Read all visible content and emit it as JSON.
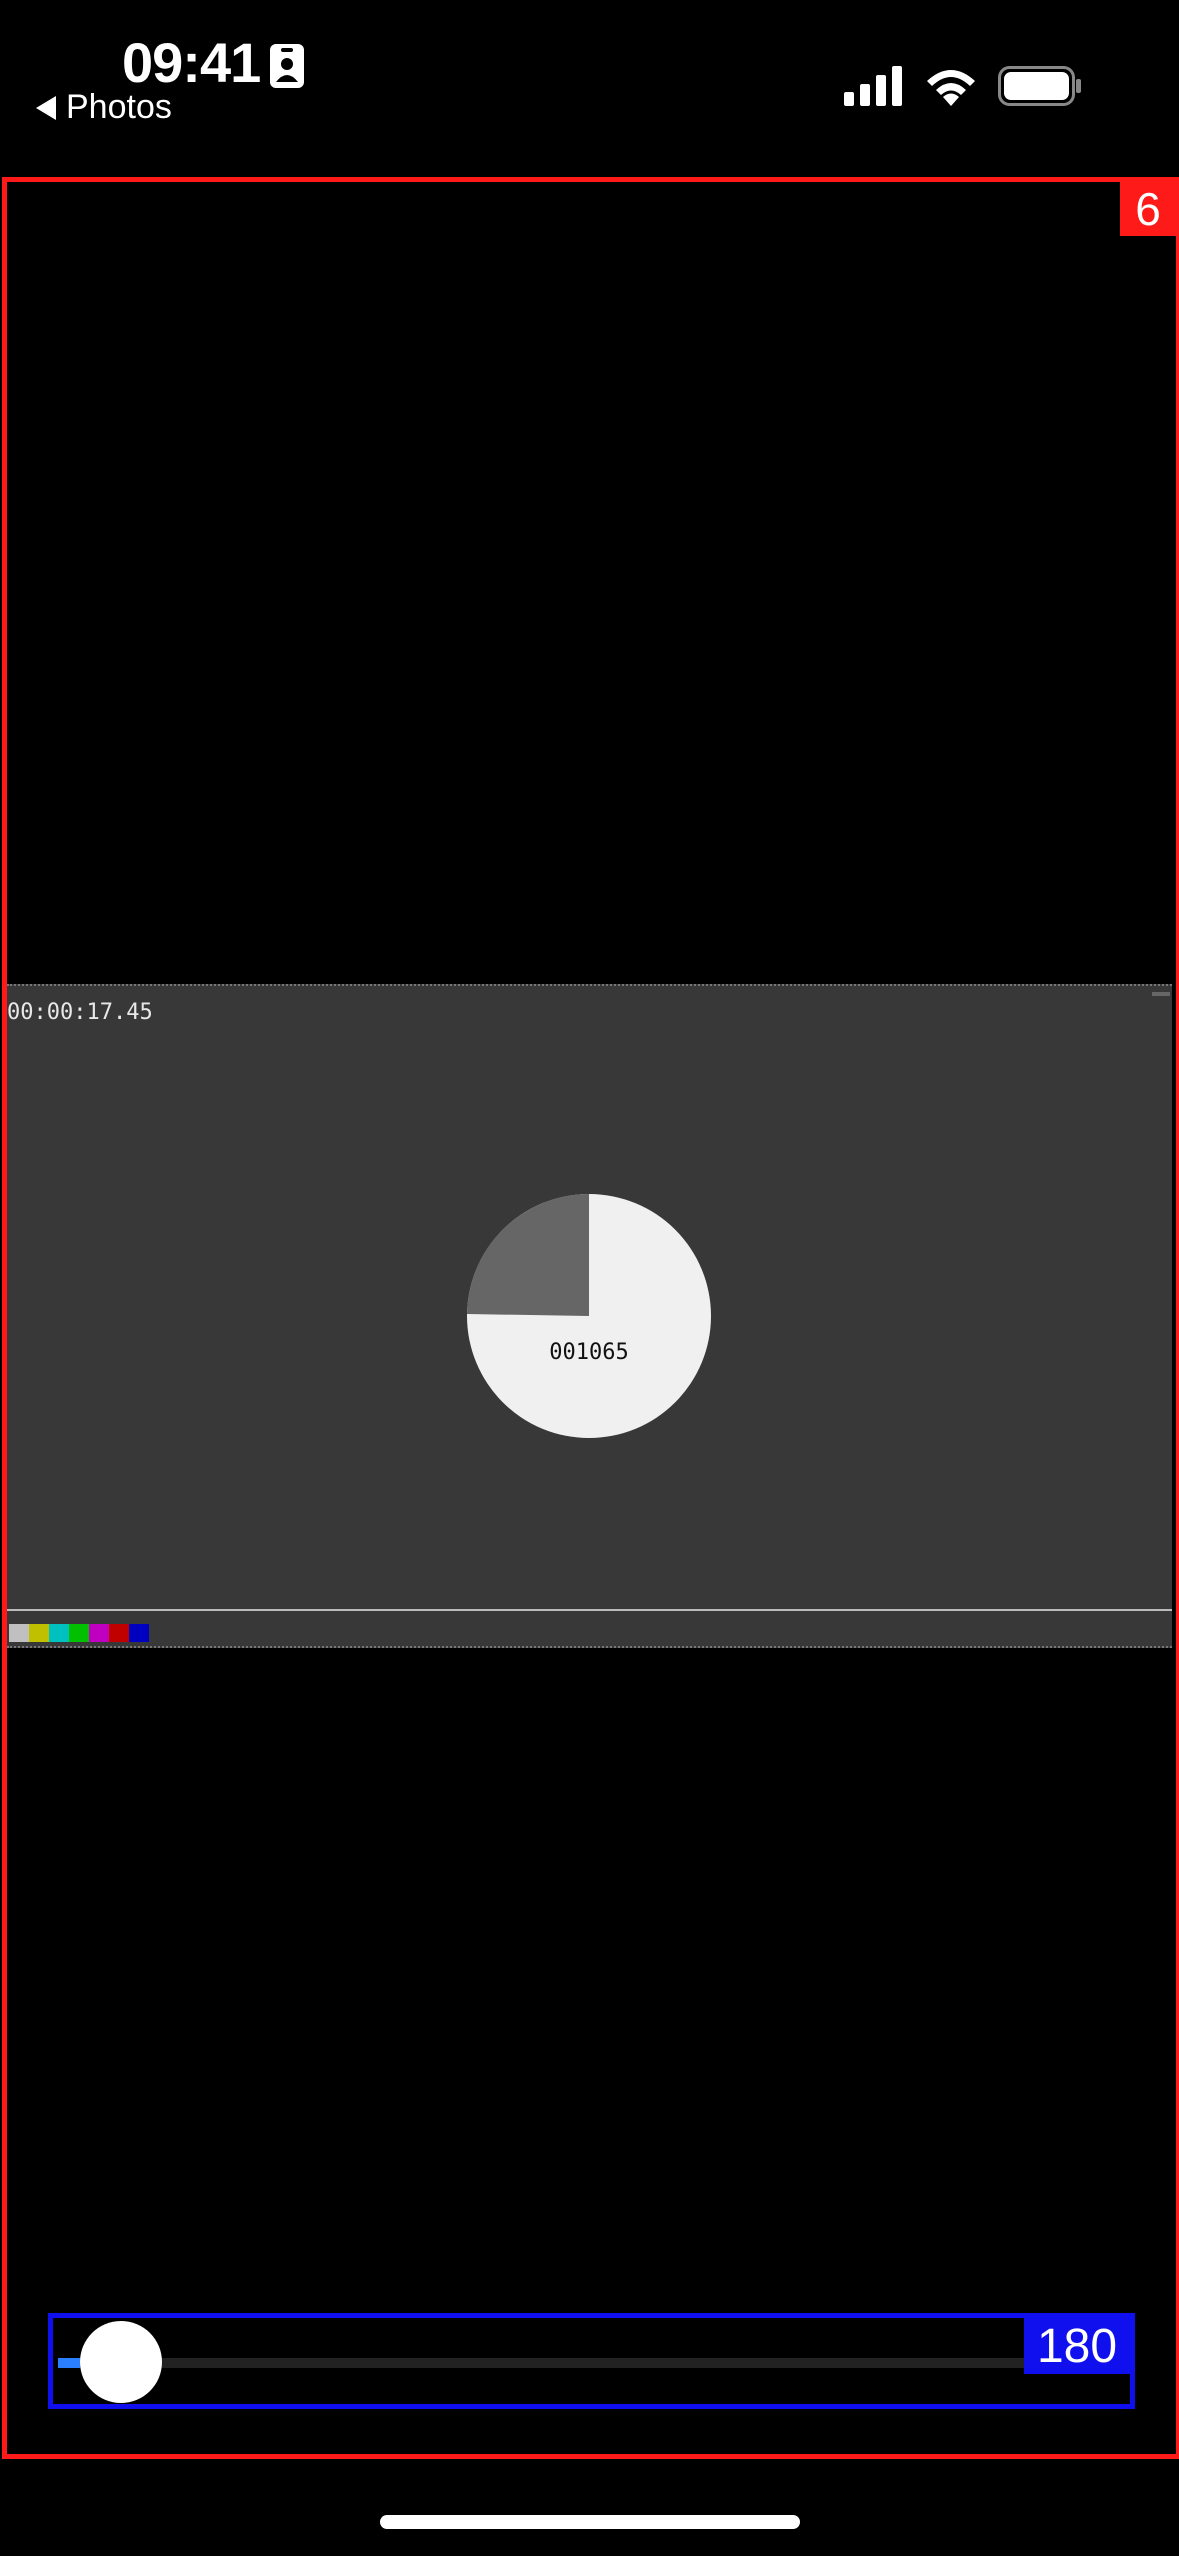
{
  "status_bar": {
    "time": "09:41",
    "back_label": "Photos"
  },
  "overlay": {
    "badge": "6",
    "slider_value": "180",
    "slider_progress": 0.0
  },
  "video": {
    "timecode": "00:00:17.45",
    "frame_counter": "001065",
    "color_bars": [
      "#c0c0c0",
      "#c0c000",
      "#00c0c0",
      "#00c000",
      "#c000c0",
      "#c00000",
      "#0000c0"
    ]
  }
}
